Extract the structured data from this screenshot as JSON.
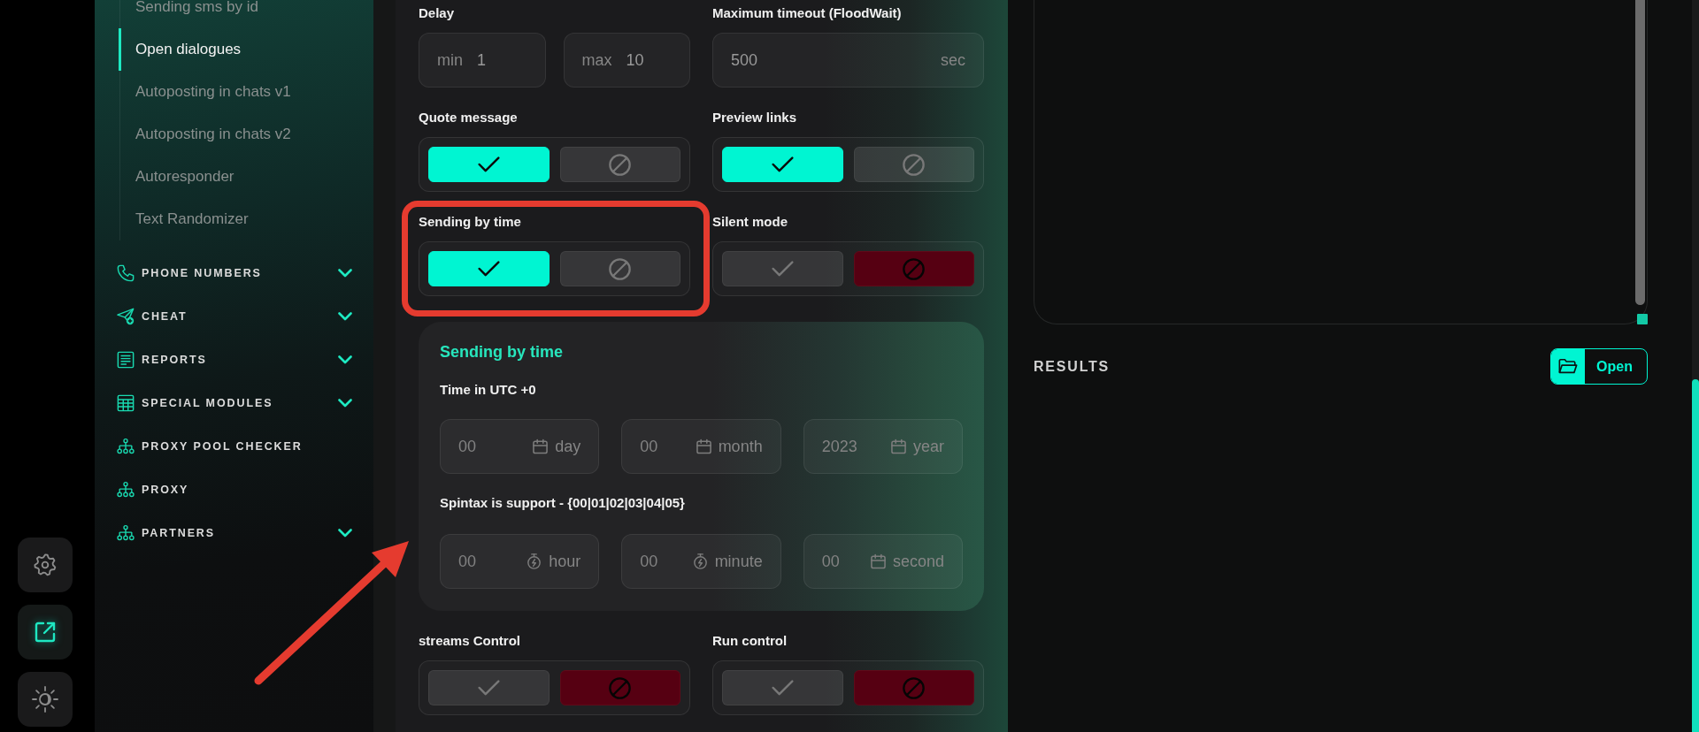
{
  "rail": [
    {
      "kind": "settings",
      "selected": false
    },
    {
      "kind": "open",
      "selected": true
    },
    {
      "kind": "theme",
      "selected": false
    }
  ],
  "sidebar": {
    "items": [
      {
        "label": "Sending sms by id",
        "selected": false
      },
      {
        "label": "Open dialogues",
        "selected": true
      },
      {
        "label": "Autoposting in chats v1",
        "selected": false
      },
      {
        "label": "Autoposting in chats v2",
        "selected": false
      },
      {
        "label": "Autoresponder",
        "selected": false
      },
      {
        "label": "Text Randomizer",
        "selected": false
      }
    ],
    "sections": [
      {
        "kind": "phone",
        "label": "PHONE NUMBERS",
        "has_submenu": true
      },
      {
        "kind": "send",
        "label": "CHEAT",
        "has_submenu": true
      },
      {
        "kind": "report",
        "label": "REPORTS",
        "has_submenu": true
      },
      {
        "kind": "table",
        "label": "SPECIAL MODULES",
        "has_submenu": true
      },
      {
        "kind": "network",
        "label": "PROXY POOL CHECKER",
        "has_submenu": false
      },
      {
        "kind": "network",
        "label": "PROXY",
        "has_submenu": false
      },
      {
        "kind": "network",
        "label": "PARTNERS",
        "has_submenu": true
      }
    ]
  },
  "form": {
    "delay": {
      "label": "Delay",
      "fields": [
        {
          "prefix": "min",
          "value": "1"
        },
        {
          "prefix": "max",
          "value": "10"
        }
      ]
    },
    "max_timeout": {
      "label": "Maximum timeout (FloodWait)",
      "value": "500",
      "suffix": "sec"
    },
    "toggles": [
      {
        "label": "Quote message",
        "buttons": [
          {
            "kind": "yes",
            "selected": true
          },
          {
            "kind": "no",
            "selected": false
          }
        ]
      },
      {
        "label": "Preview links",
        "buttons": [
          {
            "kind": "yes",
            "selected": true
          },
          {
            "kind": "no",
            "selected": false
          }
        ]
      },
      {
        "label": "Sending by time",
        "buttons": [
          {
            "kind": "yes",
            "selected": true
          },
          {
            "kind": "no",
            "selected": false
          }
        ]
      },
      {
        "label": "Silent mode",
        "buttons": [
          {
            "kind": "yes",
            "selected": false
          },
          {
            "kind": "no",
            "selected": true
          }
        ]
      }
    ],
    "schedule": {
      "title": "Sending by time",
      "date_label": "Time in UTC +0",
      "date_fields": [
        {
          "kind": "date",
          "placeholder": "00",
          "unit": "day"
        },
        {
          "kind": "date",
          "placeholder": "00",
          "unit": "month"
        },
        {
          "kind": "date",
          "placeholder": "2023",
          "unit": "year"
        }
      ],
      "time_label": "Spintax is support - {00|01|02|03|04|05}",
      "time_fields": [
        {
          "kind": "timer",
          "placeholder": "00",
          "unit": "hour"
        },
        {
          "kind": "timer",
          "placeholder": "00",
          "unit": "minute"
        },
        {
          "kind": "date",
          "placeholder": "00",
          "unit": "second"
        }
      ]
    },
    "controls": [
      {
        "label": "streams Control",
        "buttons": [
          {
            "kind": "yes",
            "selected": false
          },
          {
            "kind": "no",
            "selected": true
          }
        ]
      },
      {
        "label": "Run control",
        "buttons": [
          {
            "kind": "yes",
            "selected": false
          },
          {
            "kind": "no",
            "selected": true
          }
        ]
      }
    ]
  },
  "results": {
    "title": "RESULTS",
    "button": "Open"
  },
  "annotations": {
    "highlight_frame": true,
    "arrow": true
  }
}
